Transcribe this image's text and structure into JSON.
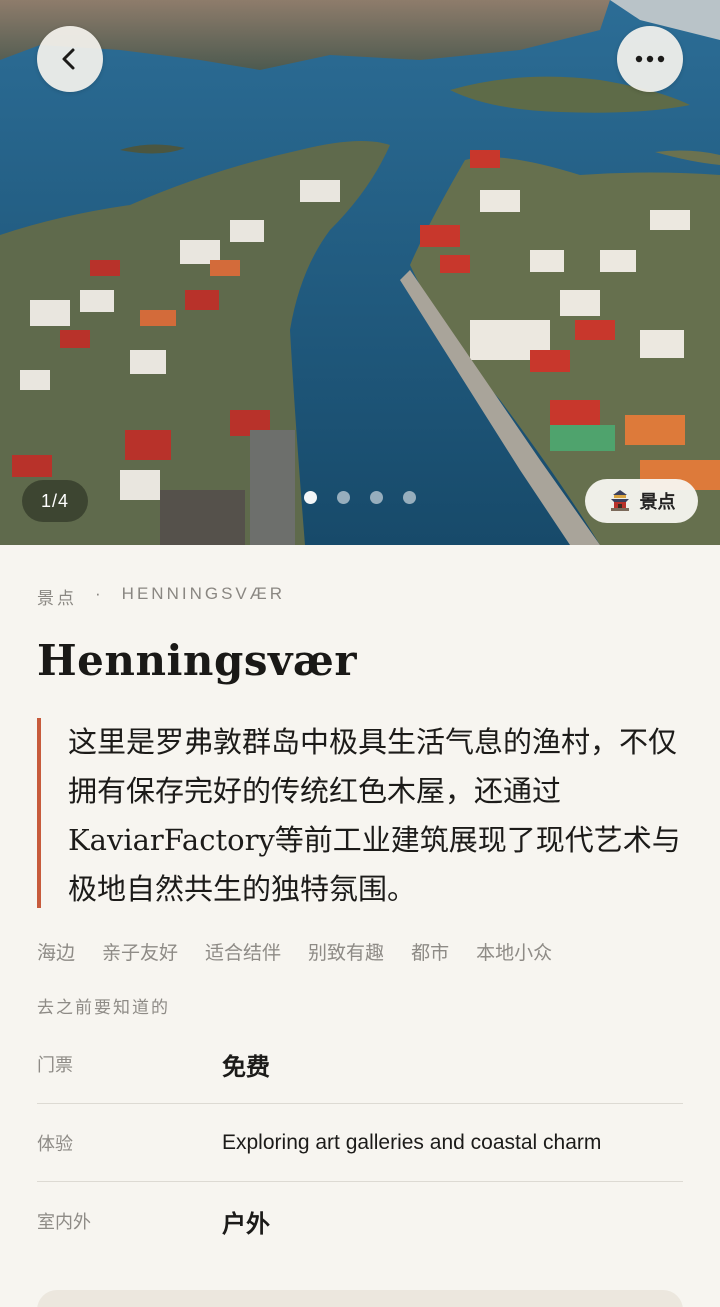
{
  "hero": {
    "counter": "1/4",
    "total_images": 4,
    "active_index": 1,
    "category_pill": "景点",
    "icons": {
      "back": "chevron-left-icon",
      "more": "more-dots-icon",
      "category": "temple-icon"
    }
  },
  "eyebrow": {
    "category": "景点",
    "separator": "·",
    "place": "HENNINGSVÆR"
  },
  "title": "Henningsvær",
  "description": "这里是罗弗敦群岛中极具生活气息的渔村，不仅拥有保存完好的传统红色木屋，还通过KaviarFactory等前工业建筑展现了现代艺术与极地自然共生的独特氛围。",
  "tags": [
    "海边",
    "亲子友好",
    "适合结伴",
    "别致有趣",
    "都市",
    "本地小众"
  ],
  "info": {
    "section_title": "去之前要知道的",
    "rows": [
      {
        "label": "门票",
        "value": "免费"
      },
      {
        "label": "体验",
        "value": "Exploring art galleries and coastal charm"
      },
      {
        "label": "室内外",
        "value": "户外"
      }
    ]
  },
  "colors": {
    "accent": "#c75b3c",
    "background": "#f7f5f0",
    "muted_text": "#8e8b86"
  }
}
